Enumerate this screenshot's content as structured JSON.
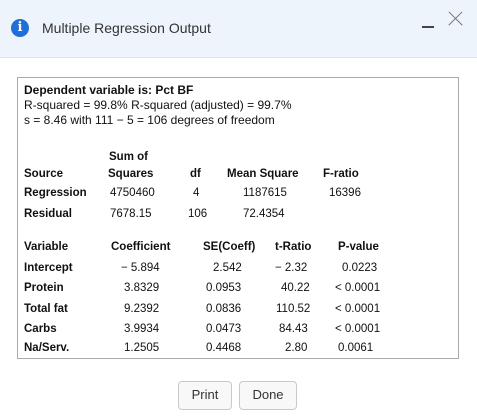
{
  "window": {
    "title": "Multiple Regression Output",
    "info_icon": "info-icon",
    "minimize_icon": "minimize-icon",
    "close_icon": "close-icon"
  },
  "output": {
    "dependent": "Dependent variable is: Pct BF",
    "rsq": "R-squared = 99.8%   R-squared (adjusted) = 99.7%",
    "s_line": "s = 8.46 with 111 − 5 = 106 degrees of freedom",
    "anova": {
      "headers": {
        "sum_of": "Sum of",
        "source": "Source",
        "squares": "Squares",
        "df": "df",
        "mean_square": "Mean Square",
        "f_ratio": "F-ratio"
      },
      "rows": [
        {
          "source": "Regression",
          "ss": "4750460",
          "df": "4",
          "ms": "1187615",
          "f": "16396"
        },
        {
          "source": "Residual",
          "ss": "7678.15",
          "df": "106",
          "ms": "72.4354",
          "f": ""
        }
      ]
    },
    "coef": {
      "headers": {
        "variable": "Variable",
        "coefficient": "Coefficient",
        "se": "SE(Coeff)",
        "t": "t-Ratio",
        "p": "P-value"
      },
      "rows": [
        {
          "variable": "Intercept",
          "coefficient": "− 5.894",
          "se": "2.542",
          "t": "− 2.32",
          "p": "0.0223"
        },
        {
          "variable": "Protein",
          "coefficient": "3.8329",
          "se": "0.0953",
          "t": "40.22",
          "p": "< 0.0001"
        },
        {
          "variable": "Total fat",
          "coefficient": "9.2392",
          "se": "0.0836",
          "t": "110.52",
          "p": "< 0.0001"
        },
        {
          "variable": "Carbs",
          "coefficient": "3.9934",
          "se": "0.0473",
          "t": "84.43",
          "p": "< 0.0001"
        },
        {
          "variable": "Na/Serv.",
          "coefficient": "1.2505",
          "se": "0.4468",
          "t": "2.80",
          "p": "0.0061"
        }
      ]
    }
  },
  "buttons": {
    "print": "Print",
    "done": "Done"
  }
}
